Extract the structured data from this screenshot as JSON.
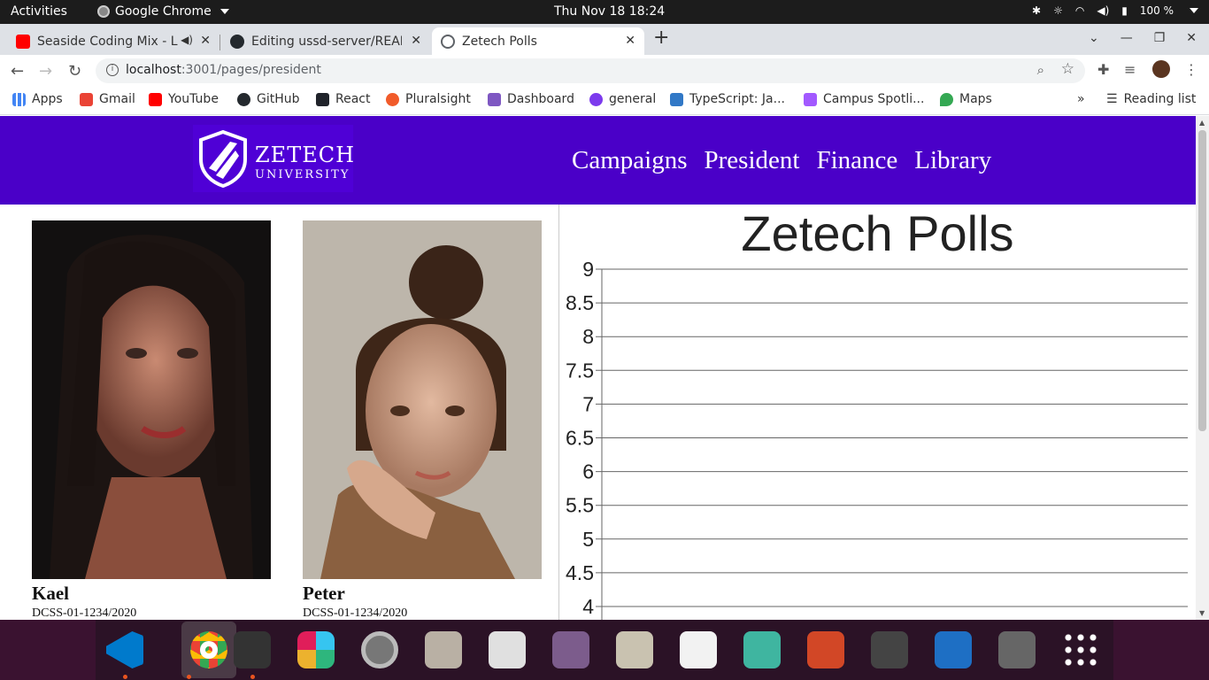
{
  "system": {
    "activities": "Activities",
    "app_name": "Google Chrome",
    "clock": "Thu Nov 18  18:24",
    "battery": "100 %"
  },
  "tabs": [
    {
      "title": "Seaside Coding Mix - L",
      "icon": "youtube-icon",
      "color": "#ff0000"
    },
    {
      "title": "Editing ussd-server/READ",
      "icon": "github-icon",
      "color": "#24292e"
    },
    {
      "title": "Zetech Polls",
      "icon": "globe-icon",
      "color": "#5f6368"
    }
  ],
  "omnibox": {
    "url_host": "localhost",
    "url_path": ":3001/pages/president"
  },
  "bookmarks": [
    {
      "label": "Apps",
      "color": "#4285f4"
    },
    {
      "label": "Gmail",
      "color": "#ea4335"
    },
    {
      "label": "YouTube",
      "color": "#ff0000"
    },
    {
      "label": "GitHub",
      "color": "#24292e"
    },
    {
      "label": "React",
      "color": "#20232a"
    },
    {
      "label": "Pluralsight",
      "color": "#f15b2a"
    },
    {
      "label": "Dashboard",
      "color": "#7e57c2"
    },
    {
      "label": "general",
      "color": "#7c3aed"
    },
    {
      "label": "TypeScript: Ja...",
      "color": "#3178c6"
    },
    {
      "label": "Campus Spotli...",
      "color": "#a259ff"
    },
    {
      "label": "Maps",
      "color": "#34a853"
    }
  ],
  "reading_list": "Reading list",
  "site": {
    "logo_line1": "ZETECH",
    "logo_line2": "UNIVERSITY",
    "brand_color": "#4a00c8",
    "nav": [
      "Campaigns",
      "President",
      "Finance",
      "Library"
    ]
  },
  "candidates": [
    {
      "name": "Kael",
      "id": "DCSS-01-1234/2020"
    },
    {
      "name": "Peter",
      "id": "DCSS-01-1234/2020"
    }
  ],
  "chart_data": {
    "type": "bar",
    "title": "Zetech Polls",
    "categories": [],
    "values": [],
    "y_ticks": [
      "9",
      "8.5",
      "8",
      "7.5",
      "7",
      "6.5",
      "6",
      "5.5",
      "5",
      "4.5",
      "4"
    ],
    "ylim": [
      4,
      9
    ],
    "grid": true
  },
  "dock": [
    {
      "name": "vscode-icon",
      "color": "#007acc",
      "running": true
    },
    {
      "name": "chrome-icon",
      "color": "#4285f4",
      "running": true,
      "selected": true
    },
    {
      "name": "terminal-icon",
      "color": "#333333",
      "running": true
    },
    {
      "name": "slack-icon",
      "color": "#ffffff"
    },
    {
      "name": "settings-icon",
      "color": "#777777"
    },
    {
      "name": "files-icon",
      "color": "#b9b0a4"
    },
    {
      "name": "document-viewer-icon",
      "color": "#e0e0e0"
    },
    {
      "name": "tweaks-icon",
      "color": "#7c5c8c"
    },
    {
      "name": "archive-icon",
      "color": "#c9c2b0"
    },
    {
      "name": "text-editor-icon",
      "color": "#f2f2f2"
    },
    {
      "name": "remote-desktop-icon",
      "color": "#3fb5a0"
    },
    {
      "name": "impress-icon",
      "color": "#d24726"
    },
    {
      "name": "system-monitor-icon",
      "color": "#444444"
    },
    {
      "name": "writer-icon",
      "color": "#1e6fc4"
    },
    {
      "name": "usb-creator-icon",
      "color": "#666666"
    },
    {
      "name": "show-apps-icon",
      "color": "#ffffff"
    }
  ]
}
